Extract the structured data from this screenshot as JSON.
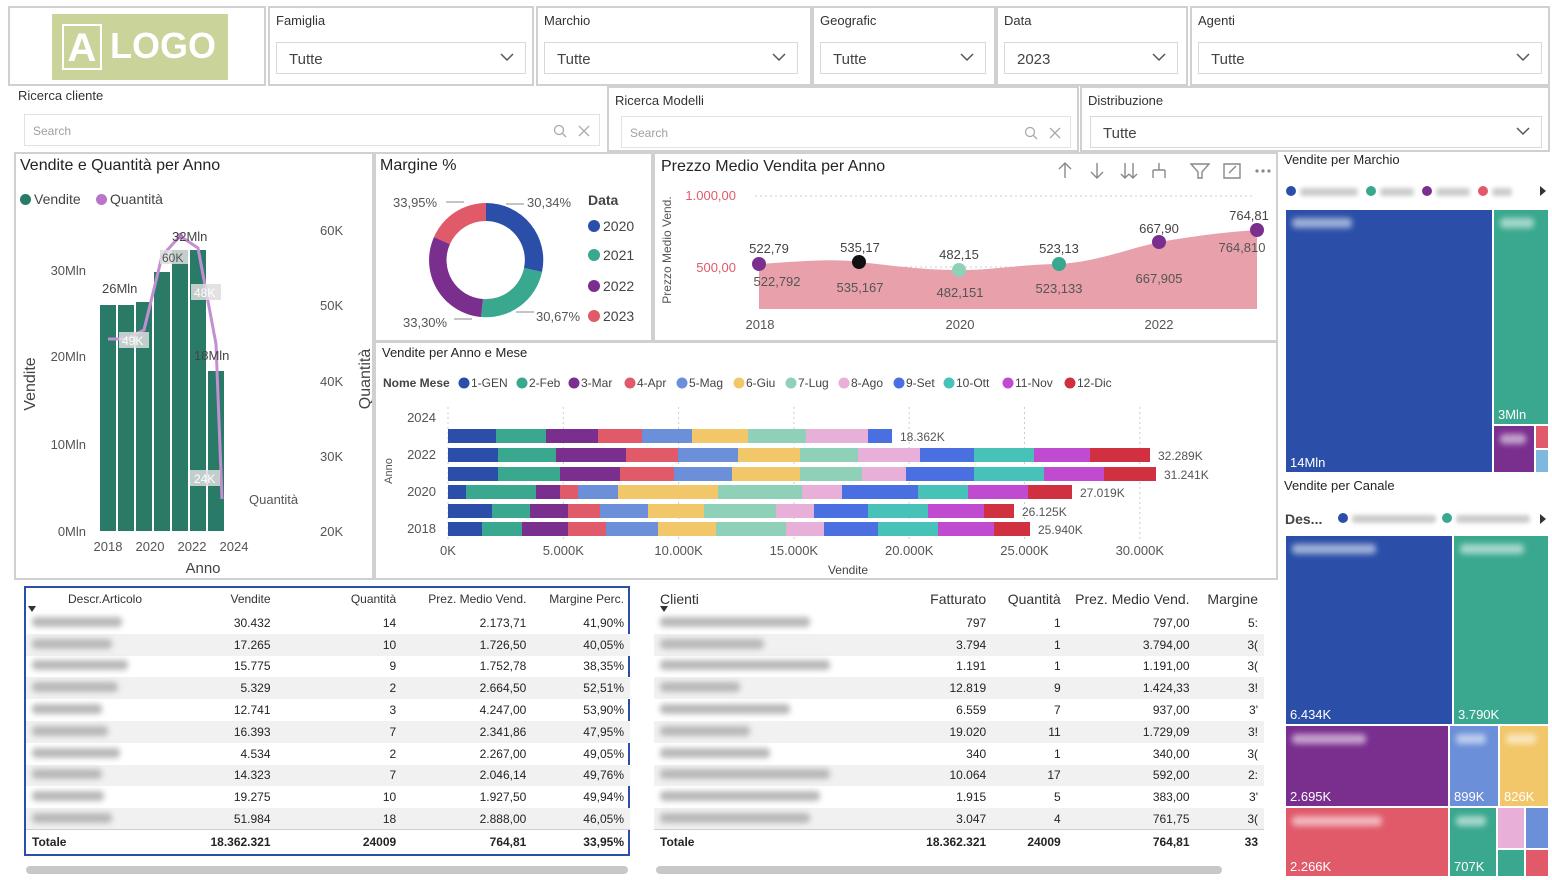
{
  "logo": {
    "text": "LOGO",
    "mark": "A"
  },
  "slicers": {
    "famiglia": {
      "title": "Famiglia",
      "value": "Tutte"
    },
    "marchio": {
      "title": "Marchio",
      "value": "Tutte"
    },
    "geografic": {
      "title": "Geografic",
      "value": "Tutte"
    },
    "data": {
      "title": "Data",
      "value": "2023"
    },
    "agenti": {
      "title": "Agenti",
      "value": "Tutte"
    },
    "ricerca_cliente": {
      "title": "Ricerca cliente",
      "placeholder": "Search"
    },
    "ricerca_modelli": {
      "title": "Ricerca Modelli",
      "placeholder": "Search"
    },
    "distribuzione": {
      "title": "Distribuzione",
      "value": "Tutte"
    }
  },
  "colors": {
    "teal": "#2a7a68",
    "purple": "#b776c7",
    "blue": "#2b4fa8",
    "green": "#3aa88e",
    "dpurple": "#7a2f8f",
    "red": "#e05a6a",
    "pink": "#e8a0ab"
  },
  "vendite_quantita": {
    "title": "Vendite e Quantità per Anno",
    "legend": [
      "Vendite",
      "Quantità"
    ],
    "y_left_label": "Vendite",
    "y_right_label": "Quantità",
    "x_label": "Anno",
    "extra_label": "Quantità",
    "y_left_ticks": [
      "30Mln",
      "20Mln",
      "10Mln",
      "0Mln"
    ],
    "y_right_ticks": [
      "60K",
      "50K",
      "40K",
      "30K",
      "20K"
    ],
    "x_ticks": [
      "2018",
      "2020",
      "2022",
      "2024"
    ],
    "bar_labels": [
      "26Mln",
      "32Mln",
      "18Mln"
    ],
    "line_labels": [
      "49K",
      "60K",
      "48K",
      "24K"
    ]
  },
  "margine": {
    "title": "Margine %",
    "legend_title": "Data",
    "legend": [
      "2020",
      "2021",
      "2022",
      "2023"
    ],
    "slice_labels": [
      "30,34%",
      "30,67%",
      "33,30%",
      "33,95%"
    ]
  },
  "prezzo_medio": {
    "title": "Prezzo Medio Vendita per Anno",
    "y_label": "Prezzo Medio Vend.",
    "y_ticks": [
      "1.000,00",
      "500,00"
    ],
    "x_ticks": [
      "2018",
      "2020",
      "2022"
    ],
    "top_labels": [
      "522,79",
      "535,17",
      "482,15",
      "523,13",
      "667,90",
      "764,81"
    ],
    "bottom_labels": [
      "522,792",
      "535,167",
      "482,151",
      "523,133",
      "667,905",
      "764,810"
    ]
  },
  "vendite_anno_mese": {
    "title": "Vendite per Anno e Mese",
    "legend_title": "Nome Mese",
    "months": [
      "1-GEN",
      "2-Feb",
      "3-Mar",
      "4-Apr",
      "5-Mag",
      "6-Giu",
      "7-Lug",
      "8-Ago",
      "9-Set",
      "10-Ott",
      "11-Nov",
      "12-Dic"
    ],
    "y_label": "Anno",
    "y_ticks": [
      "2024",
      "2022",
      "2020",
      "2018"
    ],
    "x_label": "Vendite",
    "x_ticks": [
      "0K",
      "5.000K",
      "10.000K",
      "15.000K",
      "20.000K",
      "25.000K",
      "30.000K"
    ],
    "total_labels": [
      "18.362K",
      "32.289K",
      "31.241K",
      "27.019K",
      "26.125K",
      "25.940K"
    ]
  },
  "vendite_marchio": {
    "title": "Vendite per Marchio",
    "labels": [
      "14Mln",
      "3Mln"
    ]
  },
  "vendite_canale": {
    "title": "Vendite per Canale",
    "legend_title": "Des...",
    "labels": [
      "6.434K",
      "3.790K",
      "2.695K",
      "899K",
      "826K",
      "2.266K",
      "707K"
    ]
  },
  "articoli_table": {
    "columns": [
      "Descr.Articolo",
      "Vendite",
      "Quantità",
      "Prez. Medio Vend.",
      "Margine Perc."
    ],
    "rows": [
      [
        "30.432",
        "14",
        "2.173,71",
        "41,90%"
      ],
      [
        "17.265",
        "10",
        "1.726,50",
        "40,05%"
      ],
      [
        "15.775",
        "9",
        "1.752,78",
        "38,35%"
      ],
      [
        "5.329",
        "2",
        "2.664,50",
        "52,51%"
      ],
      [
        "12.741",
        "3",
        "4.247,00",
        "53,90%"
      ],
      [
        "16.393",
        "7",
        "2.341,86",
        "47,95%"
      ],
      [
        "4.534",
        "2",
        "2.267,00",
        "49,05%"
      ],
      [
        "14.323",
        "7",
        "2.046,14",
        "49,76%"
      ],
      [
        "19.275",
        "10",
        "1.927,50",
        "49,94%"
      ],
      [
        "51.984",
        "18",
        "2.888,00",
        "46,05%"
      ]
    ],
    "total": [
      "Totale",
      "18.362.321",
      "24009",
      "764,81",
      "33,95%"
    ]
  },
  "clienti_table": {
    "columns": [
      "Clienti",
      "Fatturato",
      "Quantità",
      "Prez. Medio Vend.",
      "Margine"
    ],
    "rows": [
      [
        "797",
        "1",
        "797,00",
        "5:"
      ],
      [
        "3.794",
        "1",
        "3.794,00",
        "3("
      ],
      [
        "1.191",
        "1",
        "1.191,00",
        "3("
      ],
      [
        "12.819",
        "9",
        "1.424,33",
        "3!"
      ],
      [
        "6.559",
        "7",
        "937,00",
        "3'"
      ],
      [
        "19.020",
        "11",
        "1.729,09",
        "3!"
      ],
      [
        "340",
        "1",
        "340,00",
        "3("
      ],
      [
        "10.064",
        "17",
        "592,00",
        "2:"
      ],
      [
        "1.915",
        "5",
        "383,00",
        "3'"
      ],
      [
        "3.047",
        "4",
        "761,75",
        "3("
      ]
    ],
    "total": [
      "Totale",
      "18.362.321",
      "24009",
      "764,81",
      "33"
    ]
  }
}
